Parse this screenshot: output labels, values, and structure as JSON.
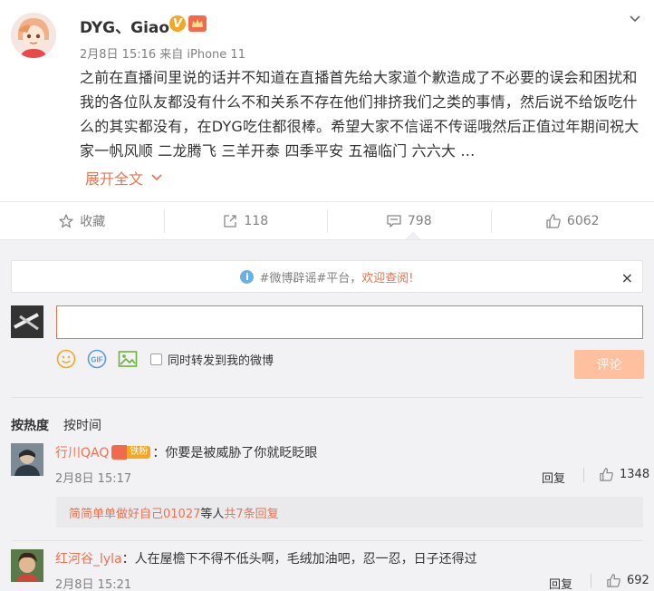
{
  "post": {
    "username": "DYG、Giao",
    "meta": "2月8日 15:16 来自 iPhone 11",
    "content": "之前在直播间里说的话并不知道在直播首先给大家道个歉造成了不必要的误会和困扰和我的各位队友都没有什么不和关系不存在他们排挤我们之类的事情，然后说不给饭吃什么的其实都没有，在DYG吃住都很棒。希望大家不信谣不传谣哦然后正值过年期间祝大家一帆风顺 二龙腾飞 三羊开泰 四季平安 五福临门 六六大 ...",
    "expand_label": "展开全文"
  },
  "actions": {
    "favorite_label": "收藏",
    "repost_count": "118",
    "comment_count": "798",
    "like_count": "6062"
  },
  "notice": {
    "prefix": "#微博辟谣#平台，",
    "highlight": "欢迎查阅!",
    "close": "×"
  },
  "composer": {
    "input_value": "",
    "also_repost_label": "同时转发到我的微博",
    "submit_label": "评论"
  },
  "sort": {
    "by_hot": "按热度",
    "by_time": "按时间"
  },
  "comments": [
    {
      "name": "行川QAQ",
      "badge": "铁粉",
      "text": "：你要是被威胁了你就眨眨眼",
      "time": "2月8日 15:17",
      "reply_label": "回复",
      "likes": "1348"
    },
    {
      "name": "红河谷_lyla",
      "text": "：人在屋檐下不得不低头啊，毛绒加油吧，忍一忍，日子还得过",
      "time": "2月8日 15:21",
      "reply_label": "回复",
      "likes": "692"
    }
  ],
  "subreply": {
    "user": "简简单单做好自己01027",
    "middle": " 等人 ",
    "count_text": "共7条回复"
  },
  "colors": {
    "accent": "#eb7350",
    "panel_bg": "#f2f2f5",
    "button_disabled": "#ffc09f"
  }
}
